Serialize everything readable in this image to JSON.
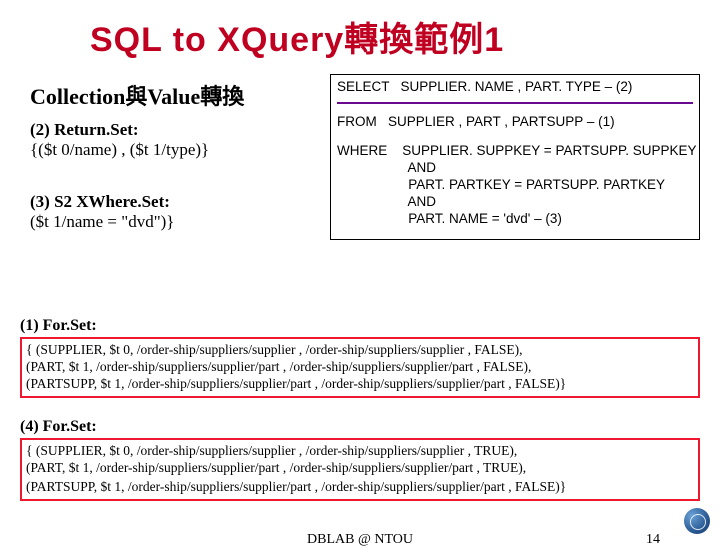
{
  "title": "SQL to XQuery轉換範例1",
  "subtitle": "Collection與Value轉換",
  "sql": {
    "select": "SELECT   SUPPLIER. NAME , PART. TYPE – (2)",
    "from": "FROM   SUPPLIER , PART , PARTSUPP – (1)",
    "where1": "WHERE    SUPPLIER. SUPPKEY = PARTSUPP. SUPPKEY",
    "where2": "                   AND",
    "where3": "                   PART. PARTKEY = PARTSUPP. PARTKEY",
    "where4": "                   AND",
    "where5": "                   PART. NAME = 'dvd' – (3)"
  },
  "left": {
    "block2_head": "(2) Return.Set:",
    "block2_body": "{($t 0/name) , ($t 1/type)}",
    "block3_head": "(3) S2 XWhere.Set:",
    "block3_body": "($t 1/name = \"dvd\")}"
  },
  "forset1": {
    "head": "(1) For.Set:",
    "l1": "{ (SUPPLIER, $t 0, /order-ship/suppliers/supplier , /order-ship/suppliers/supplier , FALSE),",
    "l2": "  (PART, $t 1, /order-ship/suppliers/supplier/part , /order-ship/suppliers/supplier/part , FALSE),",
    "l3": "  (PARTSUPP, $t 1, /order-ship/suppliers/supplier/part , /order-ship/suppliers/supplier/part , FALSE)}"
  },
  "forset4": {
    "head": "(4) For.Set:",
    "l1": "{ (SUPPLIER, $t 0, /order-ship/suppliers/supplier , /order-ship/suppliers/supplier , TRUE),",
    "l2": "  (PART, $t 1, /order-ship/suppliers/supplier/part , /order-ship/suppliers/supplier/part , TRUE),",
    "l3": "  (PARTSUPP, $t 1, /order-ship/suppliers/supplier/part , /order-ship/suppliers/supplier/part , FALSE)}"
  },
  "footer": {
    "center": "DBLAB @ NTOU",
    "page": "14"
  }
}
